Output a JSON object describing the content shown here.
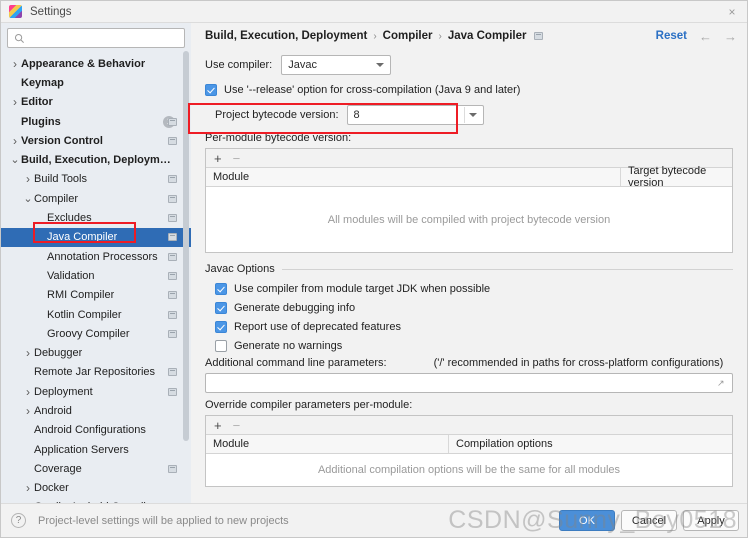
{
  "window": {
    "title": "Settings",
    "app_icon": "intellij-logo-icon",
    "close_label": "×"
  },
  "sidebar": {
    "search": {
      "placeholder": "",
      "value": "",
      "icon": "search-icon"
    },
    "items": [
      {
        "label": "Appearance & Behavior",
        "indent": 0,
        "arrow": "collapsed",
        "bold": true,
        "cfg": false,
        "badge": ""
      },
      {
        "label": "Keymap",
        "indent": 0,
        "arrow": "none",
        "bold": true,
        "cfg": false,
        "badge": ""
      },
      {
        "label": "Editor",
        "indent": 0,
        "arrow": "collapsed",
        "bold": true,
        "cfg": false,
        "badge": ""
      },
      {
        "label": "Plugins",
        "indent": 0,
        "arrow": "none",
        "bold": true,
        "cfg": true,
        "badge": "1"
      },
      {
        "label": "Version Control",
        "indent": 0,
        "arrow": "collapsed",
        "bold": true,
        "cfg": true,
        "badge": ""
      },
      {
        "label": "Build, Execution, Deployment",
        "indent": 0,
        "arrow": "expanded",
        "bold": true,
        "cfg": false,
        "badge": ""
      },
      {
        "label": "Build Tools",
        "indent": 1,
        "arrow": "collapsed",
        "bold": false,
        "cfg": true,
        "badge": ""
      },
      {
        "label": "Compiler",
        "indent": 1,
        "arrow": "expanded",
        "bold": false,
        "cfg": true,
        "badge": ""
      },
      {
        "label": "Excludes",
        "indent": 2,
        "arrow": "none",
        "bold": false,
        "cfg": true,
        "badge": ""
      },
      {
        "label": "Java Compiler",
        "indent": 2,
        "arrow": "none",
        "bold": false,
        "cfg": true,
        "badge": "",
        "selected": true,
        "highlighted": true
      },
      {
        "label": "Annotation Processors",
        "indent": 2,
        "arrow": "none",
        "bold": false,
        "cfg": true,
        "badge": ""
      },
      {
        "label": "Validation",
        "indent": 2,
        "arrow": "none",
        "bold": false,
        "cfg": true,
        "badge": ""
      },
      {
        "label": "RMI Compiler",
        "indent": 2,
        "arrow": "none",
        "bold": false,
        "cfg": true,
        "badge": ""
      },
      {
        "label": "Kotlin Compiler",
        "indent": 2,
        "arrow": "none",
        "bold": false,
        "cfg": true,
        "badge": ""
      },
      {
        "label": "Groovy Compiler",
        "indent": 2,
        "arrow": "none",
        "bold": false,
        "cfg": true,
        "badge": ""
      },
      {
        "label": "Debugger",
        "indent": 1,
        "arrow": "collapsed",
        "bold": false,
        "cfg": false,
        "badge": ""
      },
      {
        "label": "Remote Jar Repositories",
        "indent": 1,
        "arrow": "none",
        "bold": false,
        "cfg": true,
        "badge": ""
      },
      {
        "label": "Deployment",
        "indent": 1,
        "arrow": "collapsed",
        "bold": false,
        "cfg": true,
        "badge": ""
      },
      {
        "label": "Android",
        "indent": 1,
        "arrow": "collapsed",
        "bold": false,
        "cfg": false,
        "badge": ""
      },
      {
        "label": "Android Configurations",
        "indent": 1,
        "arrow": "none",
        "bold": false,
        "cfg": false,
        "badge": ""
      },
      {
        "label": "Application Servers",
        "indent": 1,
        "arrow": "none",
        "bold": false,
        "cfg": false,
        "badge": ""
      },
      {
        "label": "Coverage",
        "indent": 1,
        "arrow": "none",
        "bold": false,
        "cfg": true,
        "badge": ""
      },
      {
        "label": "Docker",
        "indent": 1,
        "arrow": "collapsed",
        "bold": false,
        "cfg": false,
        "badge": ""
      },
      {
        "label": "Gradle-Android Compiler",
        "indent": 1,
        "arrow": "none",
        "bold": false,
        "cfg": true,
        "badge": ""
      }
    ]
  },
  "main": {
    "breadcrumb": [
      "Build, Execution, Deployment",
      "Compiler",
      "Java Compiler"
    ],
    "breadcrumb_sep": "›",
    "reset_label": "Reset",
    "nav_back_icon": "arrow-left-icon",
    "nav_forward_icon": "arrow-right-icon",
    "use_compiler": {
      "label": "Use compiler:",
      "value": "Javac"
    },
    "release_option": {
      "label": "Use '--release' option for cross-compilation (Java 9 and later)",
      "checked": true
    },
    "project_bytecode": {
      "label": "Project bytecode version:",
      "value": "8"
    },
    "per_module": {
      "label": "Per-module bytecode version:",
      "add_icon": "+",
      "remove_icon": "−",
      "columns": [
        "Module",
        "Target bytecode version"
      ],
      "empty_text": "All modules will be compiled with project bytecode version",
      "rows": []
    },
    "javac_options": {
      "title": "Javac Options",
      "checkboxes": [
        {
          "label": "Use compiler from module target JDK when possible",
          "checked": true
        },
        {
          "label": "Generate debugging info",
          "checked": true
        },
        {
          "label": "Report use of deprecated features",
          "checked": true
        },
        {
          "label": "Generate no warnings",
          "checked": false
        }
      ],
      "additional_params_label": "Additional command line parameters:",
      "additional_params_hint": "('/' recommended in paths for cross-platform configurations)",
      "additional_params_value": "",
      "expand_icon": "expand-icon"
    },
    "override_per_module": {
      "label": "Override compiler parameters per-module:",
      "add_icon": "+",
      "remove_icon": "−",
      "columns": [
        "Module",
        "Compilation options"
      ],
      "empty_text": "Additional compilation options will be the same for all modules",
      "rows": []
    }
  },
  "bottom": {
    "help_icon": "?",
    "status": "Project-level settings will be applied to new projects",
    "buttons": [
      {
        "label": "OK",
        "primary": true
      },
      {
        "label": "Cancel",
        "primary": false
      },
      {
        "label": "Apply",
        "primary": false
      }
    ]
  },
  "watermark": "CSDN@Sunny_Boy0518",
  "colors": {
    "accent": "#2b70c4",
    "selection": "#2f6cb5",
    "annotation": "#ee1c25",
    "checkbox_on": "#4b96e6"
  }
}
